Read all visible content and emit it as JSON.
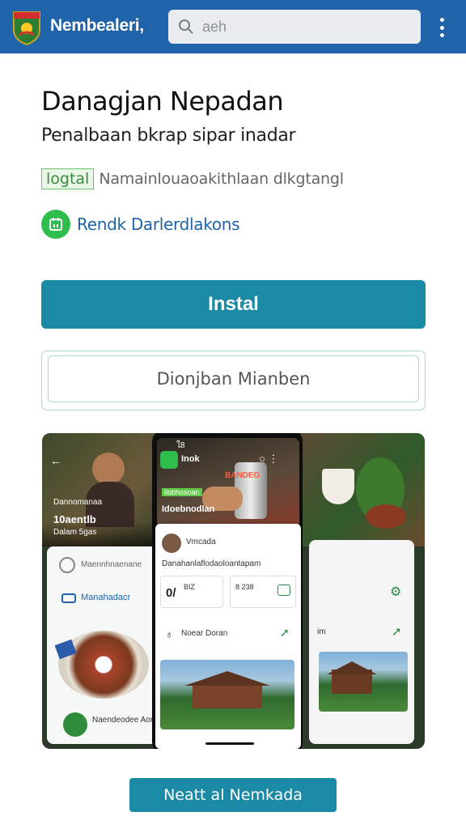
{
  "topbar": {
    "brand": "Nembealeri,",
    "search_placeholder": "aeh",
    "colors": {
      "bar": "#1f63a8",
      "accent": "#1b8aa6"
    }
  },
  "app": {
    "title": "Danagjan Nepadan",
    "subtitle": "Penalbaan bkrap sipar inadar",
    "tag": "logtal",
    "tag_desc": "Namainlouaoakithlaan dlkgtangl",
    "developer": "Rendk Darlerdlakons"
  },
  "actions": {
    "install": "Instal",
    "secondary": "Dionjban Mianben"
  },
  "gallery": {
    "left": {
      "caption_1": "Dannomanaa",
      "caption_2": "10aentlb",
      "caption_3": "Dalam 5gas",
      "row_1": "Maennhnaenane",
      "row_2": "Manahadacr",
      "row_3": "Naendeodee Aorde"
    },
    "phone": {
      "status": "ใ8",
      "app_name": "Inok",
      "banner_text": "BANDEG",
      "badge": "llobhosoan",
      "heading": "Idoebnodlan",
      "user": "Vmcada",
      "desc": "Danahanlaflodaoloantapam",
      "stat1_value": "0/",
      "stat1_label": "BIZ",
      "stat2_label": "8 238",
      "item": "Noear Doran"
    },
    "right": {
      "row": "im"
    }
  },
  "bottom_button": "Neatt al Nemkada"
}
